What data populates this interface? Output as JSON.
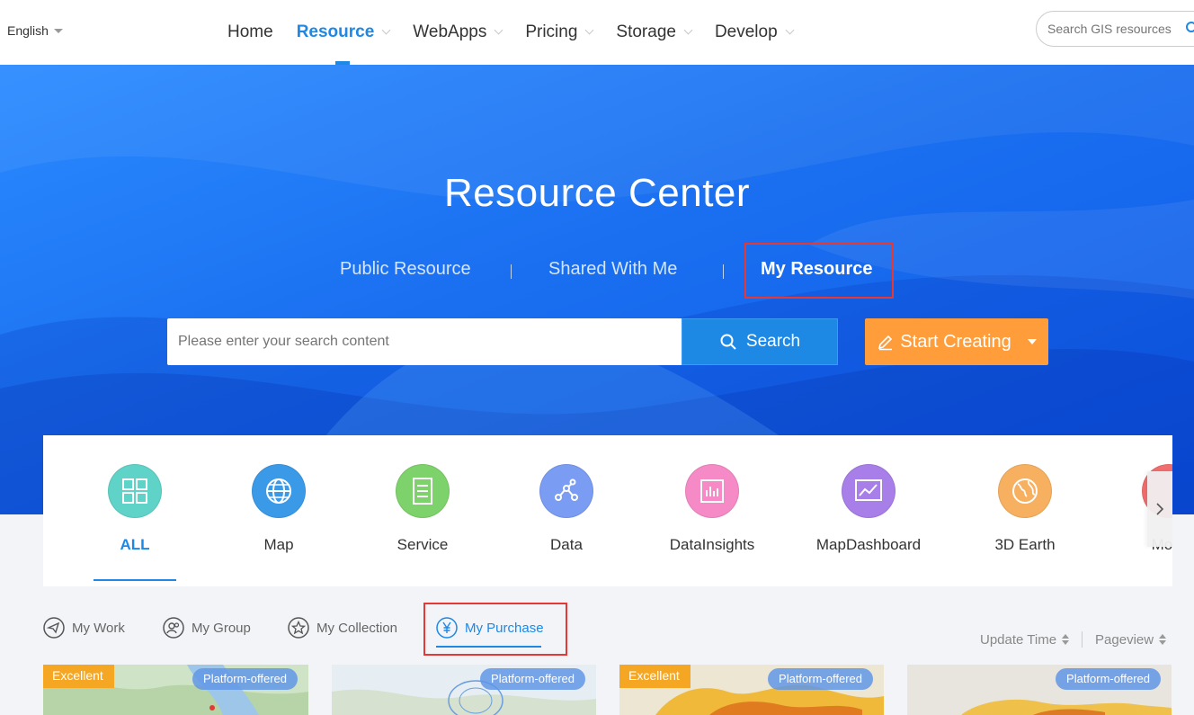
{
  "header": {
    "language": "English",
    "nav": [
      {
        "label": "Home",
        "dropdown": false
      },
      {
        "label": "Resource",
        "dropdown": true,
        "active": true
      },
      {
        "label": "WebApps",
        "dropdown": true
      },
      {
        "label": "Pricing",
        "dropdown": true
      },
      {
        "label": "Storage",
        "dropdown": true
      },
      {
        "label": "Develop",
        "dropdown": true
      }
    ],
    "search_placeholder": "Search GIS resources"
  },
  "hero": {
    "title": "Resource Center",
    "tabs": [
      {
        "label": "Public Resource"
      },
      {
        "label": "Shared With Me"
      },
      {
        "label": "My Resource",
        "active": true
      }
    ],
    "search_placeholder": "Please enter your search content",
    "search_label": "Search",
    "create_label": "Start Creating"
  },
  "categories": [
    {
      "label": "ALL",
      "icon": "grid-icon",
      "color": "#5fd3c8",
      "active": true
    },
    {
      "label": "Map",
      "icon": "globe-icon",
      "color": "#3b9ae8"
    },
    {
      "label": "Service",
      "icon": "server-icon",
      "color": "#7ed26b"
    },
    {
      "label": "Data",
      "icon": "data-nodes-icon",
      "color": "#7a9cf3"
    },
    {
      "label": "DataInsights",
      "icon": "bar-chart-icon",
      "color": "#f58ac6"
    },
    {
      "label": "MapDashboard",
      "icon": "line-chart-icon",
      "color": "#a87ee8"
    },
    {
      "label": "3D Earth",
      "icon": "earth-icon",
      "color": "#f7b060"
    },
    {
      "label": "More",
      "icon": "more-icon",
      "color": "#f26d6d"
    }
  ],
  "subtabs": [
    {
      "label": "My Work",
      "icon": "paper-plane-icon"
    },
    {
      "label": "My Group",
      "icon": "group-icon"
    },
    {
      "label": "My Collection",
      "icon": "star-icon"
    },
    {
      "label": "My Purchase",
      "icon": "yen-icon",
      "active": true
    }
  ],
  "sorts": [
    {
      "label": "Update Time"
    },
    {
      "label": "Pageview"
    }
  ],
  "cards": [
    {
      "excellent": "Excellent",
      "platform": "Platform-offered",
      "bg": "#c8dfc0"
    },
    {
      "excellent": "",
      "platform": "Platform-offered",
      "bg": "#dde8f0"
    },
    {
      "excellent": "Excellent",
      "platform": "Platform-offered",
      "bg": "#e8d9a8"
    },
    {
      "excellent": "",
      "platform": "Platform-offered",
      "bg": "#e5e3dc"
    }
  ],
  "colors": {
    "accent": "#1e88e5",
    "highlight_box": "#e53935",
    "create_button": "#ff9d3b",
    "badge_excellent": "#f5a623"
  }
}
